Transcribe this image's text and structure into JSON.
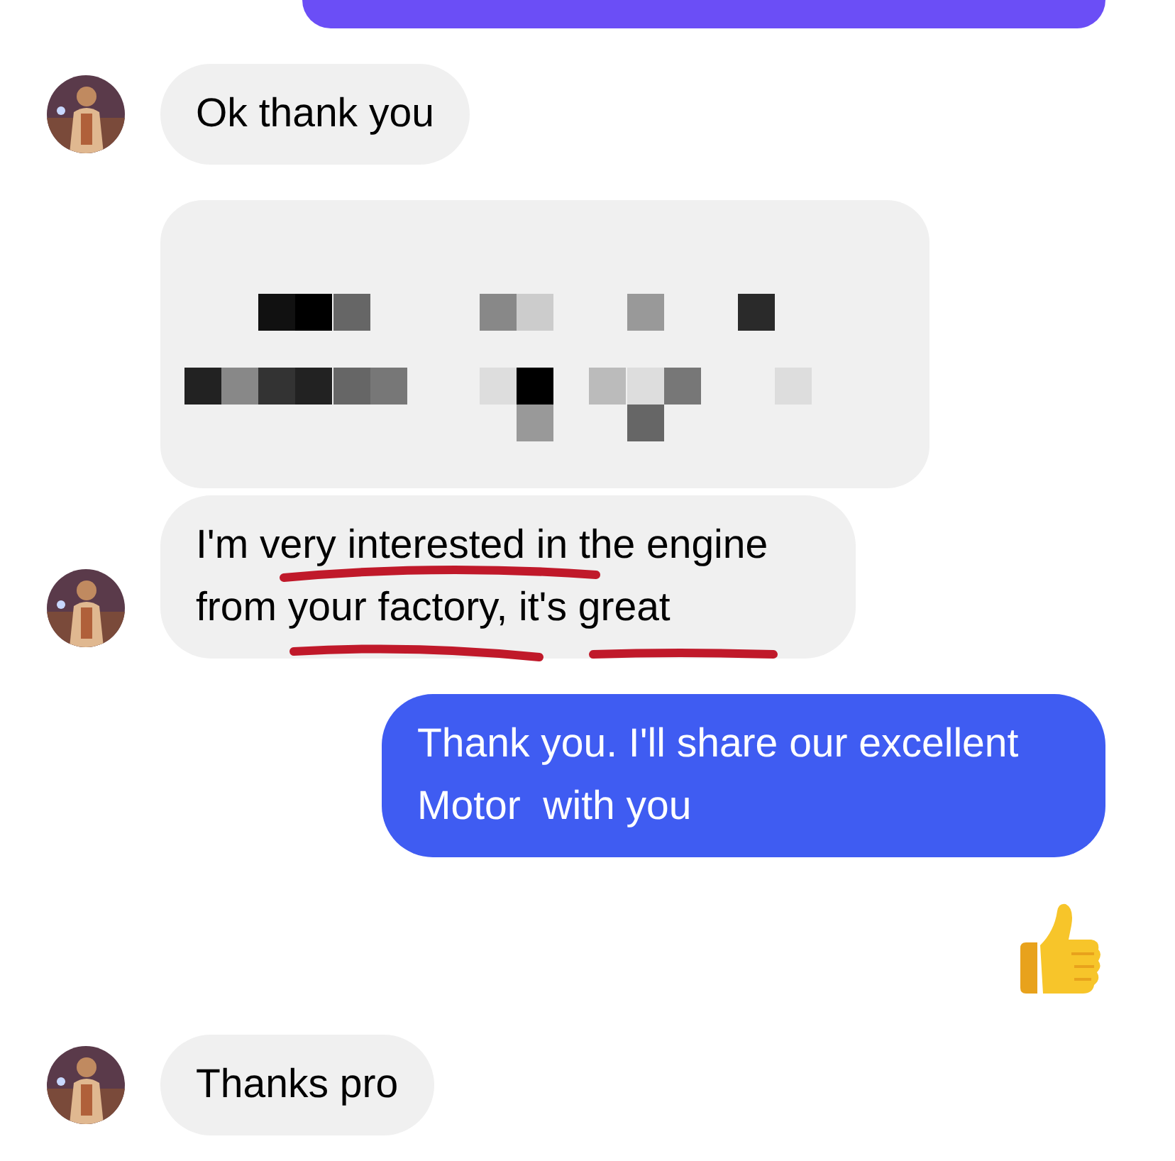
{
  "messages": [
    {
      "kind": "outgoing_cut",
      "color": "#6b4ef6"
    },
    {
      "kind": "incoming_text",
      "avatar": true,
      "continues_group": false,
      "text": "Ok thank you"
    },
    {
      "kind": "incoming_redacted",
      "avatar": false
    },
    {
      "kind": "incoming_text",
      "avatar": true,
      "continues_group": true,
      "underlined": true,
      "text": "I'm very interested in the engine from your factory, it's great"
    },
    {
      "kind": "outgoing_text",
      "color": "#3f5cf2",
      "text": "Thank you. I'll share our excellent Motor  with you"
    },
    {
      "kind": "outgoing_thumbs_up"
    },
    {
      "kind": "incoming_text",
      "avatar": true,
      "continues_group": false,
      "text": "Thanks pro"
    }
  ]
}
